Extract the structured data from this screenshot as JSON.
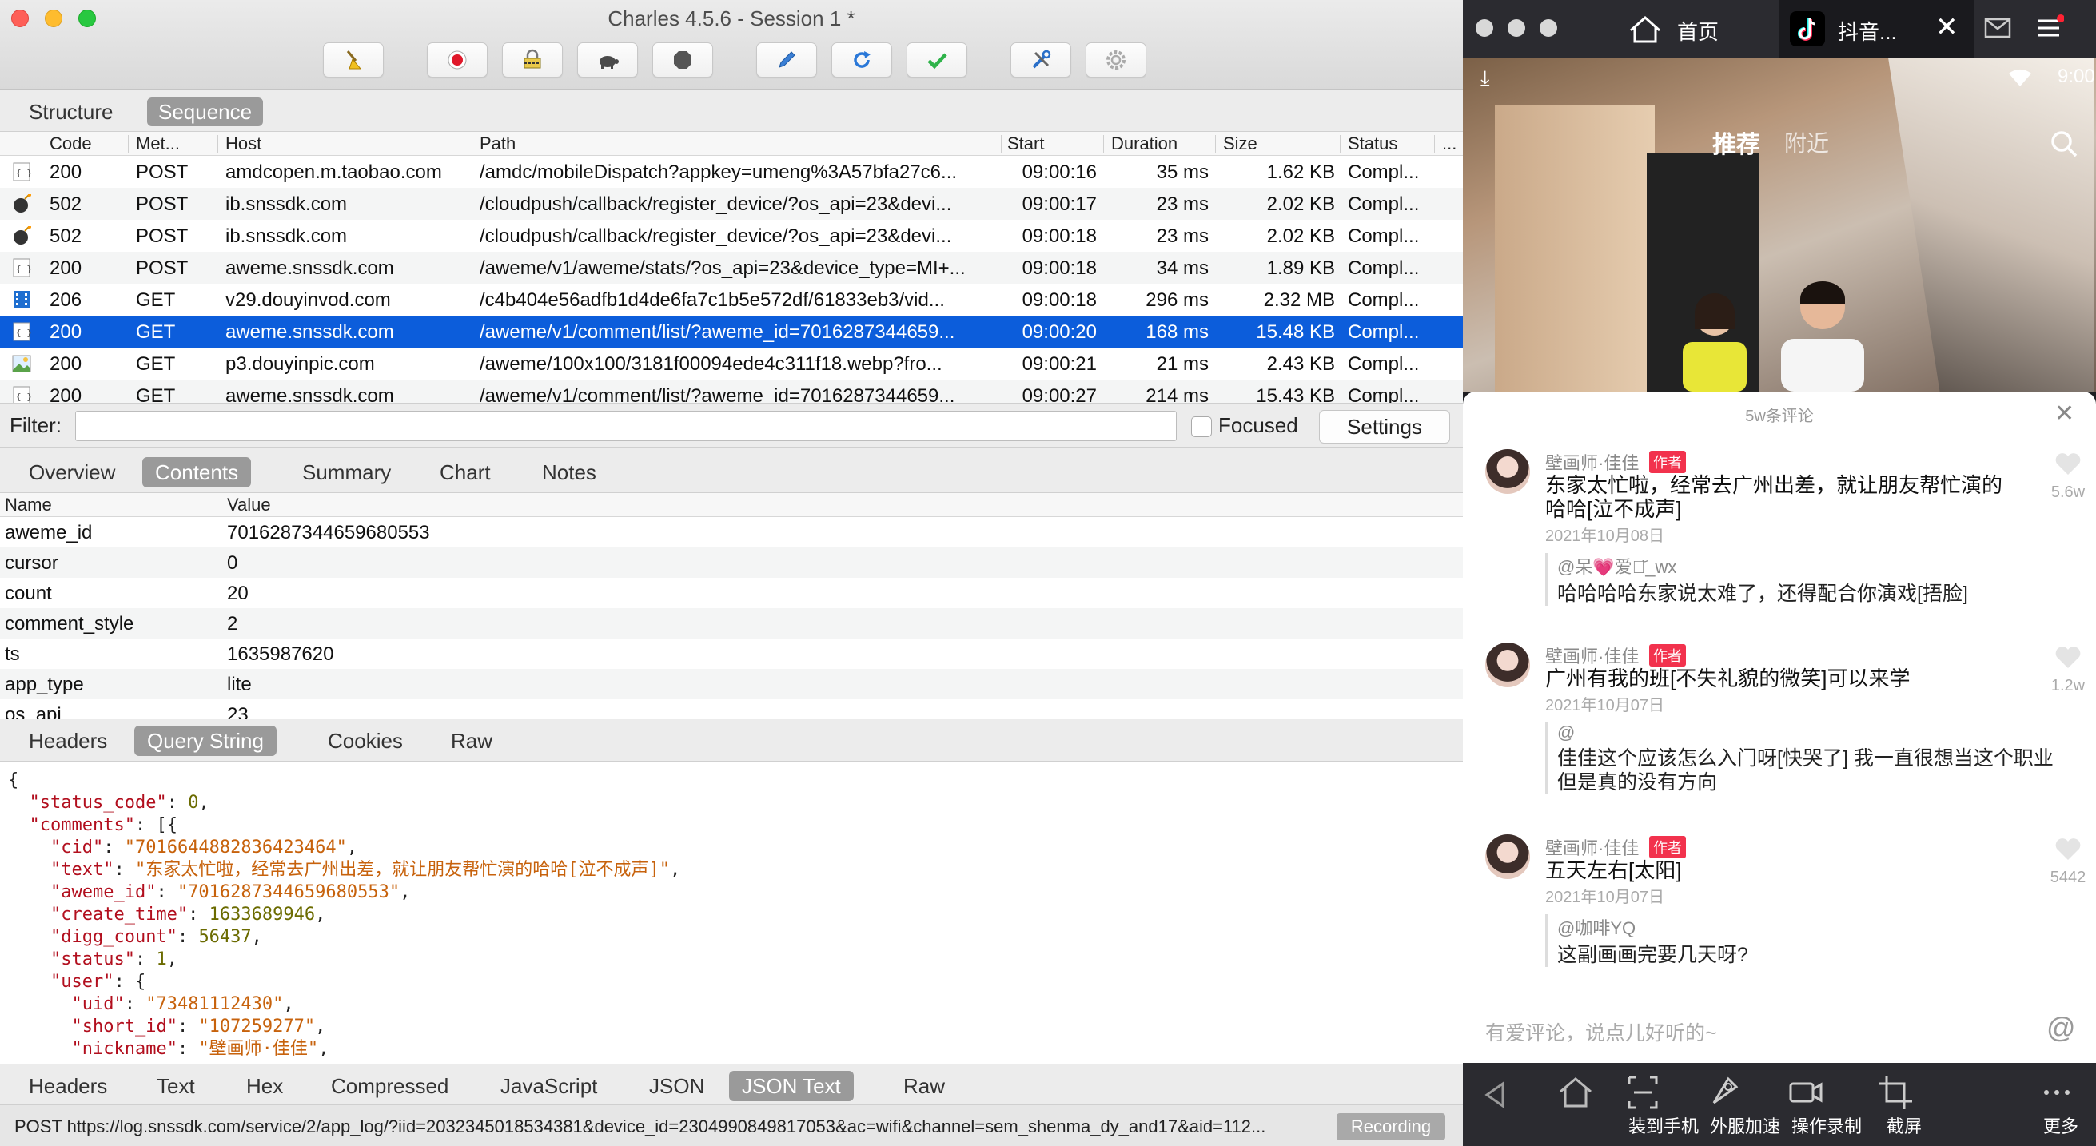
{
  "window": {
    "title": "Charles 4.5.6 - Session 1 *"
  },
  "toolbar": {
    "icons": [
      "broom-icon",
      "record-icon",
      "throttle-lock-icon",
      "turtle-icon",
      "stop-icon",
      "pen-icon",
      "refresh-icon",
      "check-icon",
      "tools-icon",
      "gear-icon"
    ]
  },
  "view_tabs": [
    "Structure",
    "Sequence"
  ],
  "sequence": {
    "columns": [
      "Code",
      "Met...",
      "Host",
      "Path",
      "Start",
      "Duration",
      "Size",
      "Status",
      "..."
    ],
    "rows": [
      {
        "code": "200",
        "method": "POST",
        "host": "amdcopen.m.taobao.com",
        "path": "/amdc/mobileDispatch?appkey=umeng%3A57bfa27c6...",
        "start": "09:00:16",
        "duration": "35 ms",
        "size": "1.62 KB",
        "status": "Compl...",
        "icon": "json-icon"
      },
      {
        "code": "502",
        "method": "POST",
        "host": "ib.snssdk.com",
        "path": "/cloudpush/callback/register_device/?os_api=23&devi...",
        "start": "09:00:17",
        "duration": "23 ms",
        "size": "2.02 KB",
        "status": "Compl...",
        "icon": "bomb-icon"
      },
      {
        "code": "502",
        "method": "POST",
        "host": "ib.snssdk.com",
        "path": "/cloudpush/callback/register_device/?os_api=23&devi...",
        "start": "09:00:18",
        "duration": "23 ms",
        "size": "2.02 KB",
        "status": "Compl...",
        "icon": "bomb-icon"
      },
      {
        "code": "200",
        "method": "POST",
        "host": "aweme.snssdk.com",
        "path": "/aweme/v1/aweme/stats/?os_api=23&device_type=MI+...",
        "start": "09:00:18",
        "duration": "34 ms",
        "size": "1.89 KB",
        "status": "Compl...",
        "icon": "json-icon"
      },
      {
        "code": "206",
        "method": "GET",
        "host": "v29.douyinvod.com",
        "path": "/c4b404e56adfb1d4de6fa7c1b5e572df/61833eb3/vid...",
        "start": "09:00:18",
        "duration": "296 ms",
        "size": "2.32 MB",
        "status": "Compl...",
        "icon": "video-icon"
      },
      {
        "code": "200",
        "method": "GET",
        "host": "aweme.snssdk.com",
        "path": "/aweme/v1/comment/list/?aweme_id=7016287344659...",
        "start": "09:00:20",
        "duration": "168 ms",
        "size": "15.48 KB",
        "status": "Compl...",
        "icon": "json-icon"
      },
      {
        "code": "200",
        "method": "GET",
        "host": "p3.douyinpic.com",
        "path": "/aweme/100x100/3181f00094ede4c311f18.webp?fro...",
        "start": "09:00:21",
        "duration": "21 ms",
        "size": "2.43 KB",
        "status": "Compl...",
        "icon": "image-icon"
      },
      {
        "code": "200",
        "method": "GET",
        "host": "aweme.snssdk.com",
        "path": "/aweme/v1/comment/list/?aweme_id=7016287344659...",
        "start": "09:00:27",
        "duration": "214 ms",
        "size": "15.43 KB",
        "status": "Compl...",
        "icon": "json-icon"
      }
    ]
  },
  "filter": {
    "label": "Filter:",
    "value": "",
    "focused_label": "Focused",
    "settings_label": "Settings"
  },
  "detail_tabs": [
    "Overview",
    "Contents",
    "Summary",
    "Chart",
    "Notes"
  ],
  "request_tabs": [
    "Headers",
    "Query String",
    "Cookies",
    "Raw"
  ],
  "query": {
    "columns": [
      "Name",
      "Value"
    ],
    "rows": [
      {
        "name": "aweme_id",
        "value": "7016287344659680553"
      },
      {
        "name": "cursor",
        "value": "0"
      },
      {
        "name": "count",
        "value": "20"
      },
      {
        "name": "comment_style",
        "value": "2"
      },
      {
        "name": "ts",
        "value": "1635987620"
      },
      {
        "name": "app_type",
        "value": "lite"
      },
      {
        "name": "os_api",
        "value": "23"
      }
    ]
  },
  "json_lines": [
    {
      "indent": "",
      "key": "",
      "val": "{",
      "t": "p"
    },
    {
      "indent": "  ",
      "key": "\"status_code\"",
      "val": "0",
      "t": "n",
      "tail": ","
    },
    {
      "indent": "  ",
      "key": "\"comments\"",
      "val": "[{",
      "t": "p"
    },
    {
      "indent": "    ",
      "key": "\"cid\"",
      "val": "\"7016644882836423464\"",
      "t": "s",
      "tail": ","
    },
    {
      "indent": "    ",
      "key": "\"text\"",
      "val": "\"东家太忙啦，经常去广州出差，就让朋友帮忙演的哈哈[泣不成声]\"",
      "t": "s",
      "tail": ","
    },
    {
      "indent": "    ",
      "key": "\"aweme_id\"",
      "val": "\"7016287344659680553\"",
      "t": "s",
      "tail": ","
    },
    {
      "indent": "    ",
      "key": "\"create_time\"",
      "val": "1633689946",
      "t": "n",
      "tail": ","
    },
    {
      "indent": "    ",
      "key": "\"digg_count\"",
      "val": "56437",
      "t": "n",
      "tail": ","
    },
    {
      "indent": "    ",
      "key": "\"status\"",
      "val": "1",
      "t": "n",
      "tail": ","
    },
    {
      "indent": "    ",
      "key": "\"user\"",
      "val": "{",
      "t": "p"
    },
    {
      "indent": "      ",
      "key": "\"uid\"",
      "val": "\"73481112430\"",
      "t": "s",
      "tail": ","
    },
    {
      "indent": "      ",
      "key": "\"short_id\"",
      "val": "\"107259277\"",
      "t": "s",
      "tail": ","
    },
    {
      "indent": "      ",
      "key": "\"nickname\"",
      "val": "\"壁画师·佳佳\"",
      "t": "s",
      "tail": ","
    }
  ],
  "response_tabs": [
    "Headers",
    "Text",
    "Hex",
    "Compressed",
    "JavaScript",
    "JSON",
    "JSON Text",
    "Raw"
  ],
  "statusbar": {
    "text": "POST https://log.snssdk.com/service/2/app_log/?iid=2032345018534381&device_id=2304990849817053&ac=wifi&channel=sem_shenma_dy_and17&aid=112...",
    "recording_label": "Recording"
  },
  "emulator": {
    "tabs": [
      {
        "label": "首页"
      },
      {
        "label": "抖音..."
      }
    ],
    "status_time": "9:00",
    "video_nav": {
      "recommend": "推荐",
      "nearby": "附近"
    },
    "comments_header": "5w条评论",
    "comments": [
      {
        "name": "壁画师·佳佳",
        "badge": "作者",
        "text": "东家太忙啦，经常去广州出差，就让朋友帮忙演的哈哈[泣不成声]",
        "date": "2021年10月08日",
        "likes": "5.6w",
        "reply_user": "@呆💗爱吃᷃_wx",
        "reply_text": "哈哈哈哈东家说太难了，还得配合你演戏[捂脸]"
      },
      {
        "name": "壁画师·佳佳",
        "badge": "作者",
        "text": "广州有我的班[不失礼貌的微笑]可以来学",
        "date": "2021年10月07日",
        "likes": "1.2w",
        "reply_user": "@",
        "reply_text": "佳佳这个应该怎么入门呀[快哭了] 我一直很想当这个职业 但是真的没有方向"
      },
      {
        "name": "壁画师·佳佳",
        "badge": "作者",
        "text": "五天左右[太阳]",
        "date": "2021年10月07日",
        "likes": "5442",
        "reply_user": "@咖啡YQ",
        "reply_text": "这副画画完要几天呀?"
      }
    ],
    "comment_placeholder": "有爱评论，说点儿好听的~",
    "bottom_buttons": [
      "",
      "",
      "装到手机",
      "外服加速",
      "操作录制",
      "截屏",
      "更多"
    ]
  }
}
